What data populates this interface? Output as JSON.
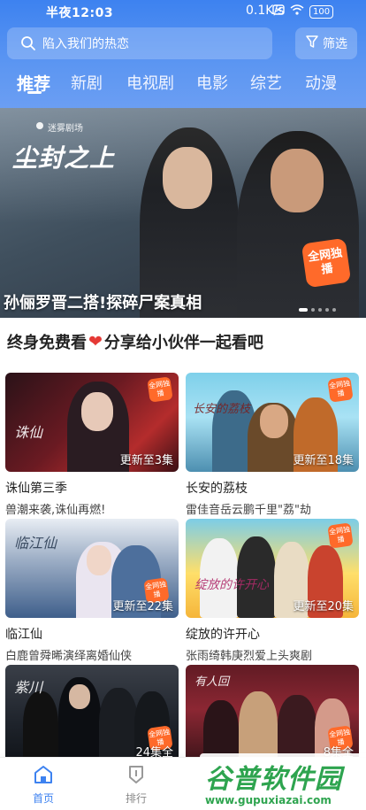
{
  "status_bar": {
    "time": "半夜12:03",
    "network_speed": "0.1K/s",
    "battery": "100"
  },
  "search": {
    "placeholder": "陷入我们的热恋"
  },
  "filter": {
    "label": "筛选"
  },
  "tabs": [
    {
      "label": "推荐",
      "active": true
    },
    {
      "label": "新剧",
      "active": false
    },
    {
      "label": "电视剧",
      "active": false
    },
    {
      "label": "电影",
      "active": false
    },
    {
      "label": "综艺",
      "active": false
    },
    {
      "label": "动漫",
      "active": false
    }
  ],
  "banner": {
    "brand": "迷雾剧场",
    "show_logo": "尘封之上",
    "badge": "全网独播",
    "caption": "孙俪罗晋二搭!探碎尸案真相",
    "slide_count": 5,
    "active_slide": 1
  },
  "promo": {
    "text_before": "终身免费看",
    "text_after": "分享给小伙伴一起看吧"
  },
  "cards": [
    {
      "title": "诛仙第三季",
      "desc": "兽潮来袭,诛仙再燃!",
      "update": "更新至3集",
      "tag": "全网独播",
      "script": "诛仙"
    },
    {
      "title": "长安的荔枝",
      "desc": "雷佳音岳云鹏千里\"荔\"劫",
      "update": "更新至18集",
      "tag": "全网独播",
      "script": "长安的荔枝"
    },
    {
      "title": "临江仙",
      "desc": "白鹿曾舜晞演绎离婚仙侠",
      "update": "更新至22集",
      "tag": "全网独播",
      "script": "临江仙"
    },
    {
      "title": "绽放的许开心",
      "desc": "张雨绮韩庚烈爱上头爽剧",
      "update": "更新至20集",
      "tag": "全网独播",
      "script": "绽放的许开心"
    },
    {
      "title": "",
      "desc": "",
      "update": "24集全",
      "tag": "全网独播",
      "script": "紫川"
    },
    {
      "title": "",
      "desc": "",
      "update": "8集全",
      "tag": "全网独播",
      "script": "有人回"
    }
  ],
  "bottom_nav": [
    {
      "label": "首页",
      "active": true
    },
    {
      "label": "排行",
      "active": false
    }
  ],
  "watermark": {
    "title": "谷普软件园",
    "url": "www.gupuxiazai.com"
  },
  "colors": {
    "accent": "#3d82f0",
    "badge": "#ff6a2a",
    "heart": "#e53935",
    "watermark": "#2ea44f"
  }
}
